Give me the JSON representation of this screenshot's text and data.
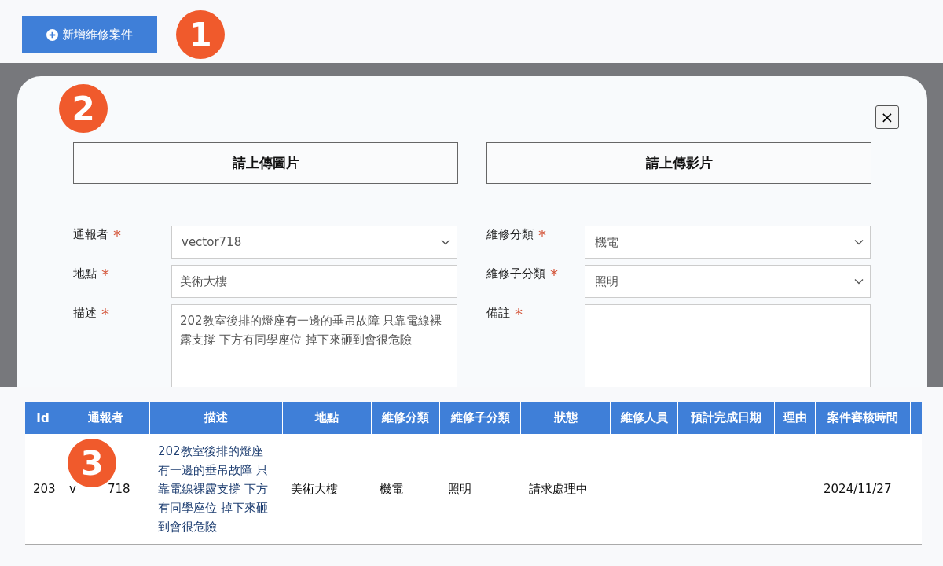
{
  "toolbar": {
    "add_button": "新增維修案件",
    "badge": "1"
  },
  "modal": {
    "badge": "2",
    "close": "×",
    "required_mark": "*",
    "uploads": [
      "請上傳圖片",
      "請上傳影片"
    ],
    "fields": [
      {
        "label": "通報者",
        "required": true,
        "kind": "select",
        "value": "vector718"
      },
      {
        "label": "維修分類",
        "required": true,
        "kind": "select",
        "value": "機電"
      },
      {
        "label": "地點",
        "required": true,
        "kind": "text",
        "value": "美術大樓"
      },
      {
        "label": "維修子分類",
        "required": true,
        "kind": "select",
        "value": "照明"
      },
      {
        "label": "描述",
        "required": true,
        "kind": "textarea",
        "value": "202教室後排的燈座有一邊的垂吊故障 只靠電線裸露支撐 下方有同學座位 掉下來砸到會很危險"
      },
      {
        "label": "備註",
        "required": true,
        "kind": "textarea"
      }
    ]
  },
  "table": {
    "badge": "3",
    "columns": [
      "Id",
      "通報者",
      "描述",
      "地點",
      "維修分類",
      "維修子分類",
      "狀態",
      "維修人員",
      "預計完成日期",
      "理由",
      "案件審核時間"
    ],
    "rows": [
      {
        "cells": [
          "203",
          [
            "v",
            "718"
          ],
          "202教室後排的燈座有一邊的垂吊故障 只靠電線裸露支撐 下方有同學座位 掉下來砸到會很危險",
          "美術大樓",
          "機電",
          "照明",
          "請求處理中",
          null,
          null,
          null,
          "2024/11/27"
        ]
      }
    ]
  }
}
